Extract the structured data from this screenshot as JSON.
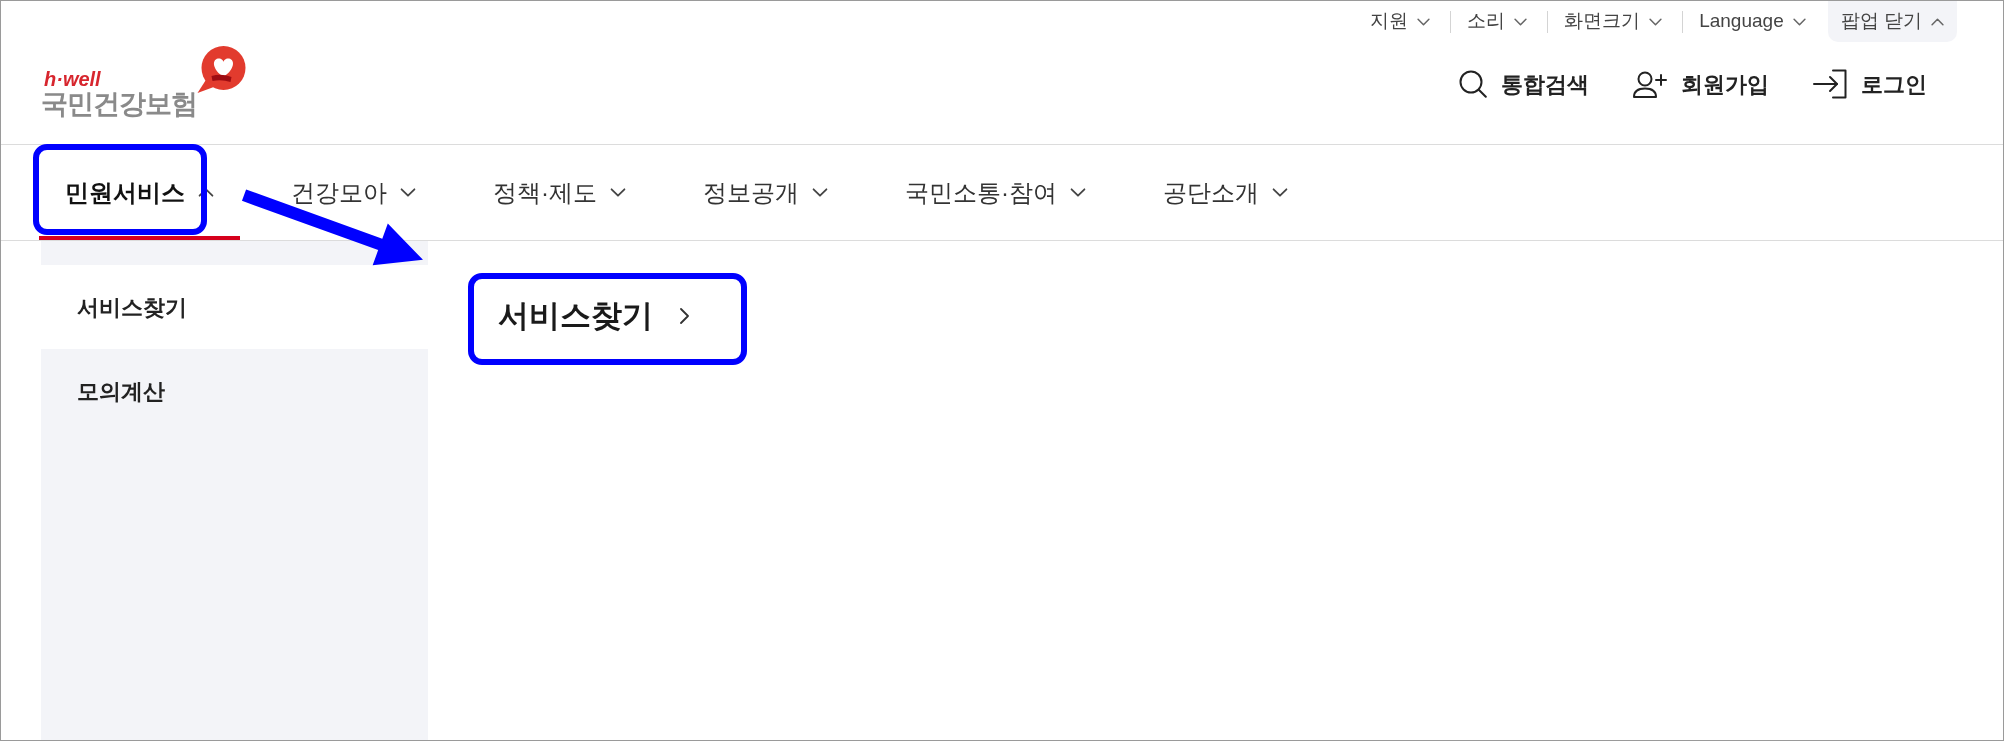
{
  "utility_menu": [
    {
      "label": "지원",
      "kind": "dropdown",
      "expanded": false
    },
    {
      "label": "소리",
      "kind": "dropdown",
      "expanded": false
    },
    {
      "label": "화면크기",
      "kind": "dropdown",
      "expanded": false
    },
    {
      "label": "Language",
      "kind": "dropdown",
      "expanded": false
    },
    {
      "label": "팝업 닫기",
      "kind": "popup_toggle",
      "expanded": true
    }
  ],
  "logo": {
    "tagline": "h·well",
    "name": "국민건강보험"
  },
  "header_actions": [
    {
      "label": "통합검색",
      "kind": "search"
    },
    {
      "label": "회원가입",
      "kind": "signup"
    },
    {
      "label": "로그인",
      "kind": "login"
    }
  ],
  "nav": [
    {
      "label": "민원서비스",
      "selected": true,
      "expanded": true
    },
    {
      "label": "건강모아",
      "selected": false,
      "expanded": false
    },
    {
      "label": "정책·제도",
      "selected": false,
      "expanded": false
    },
    {
      "label": "정보공개",
      "selected": false,
      "expanded": false
    },
    {
      "label": "국민소통·참여",
      "selected": false,
      "expanded": false
    },
    {
      "label": "공단소개",
      "selected": false,
      "expanded": false
    }
  ],
  "submenu": {
    "items": [
      {
        "label": "서비스찾기",
        "selected": true
      },
      {
        "label": "모의계산",
        "selected": false
      }
    ],
    "heading": "서비스찾기"
  }
}
